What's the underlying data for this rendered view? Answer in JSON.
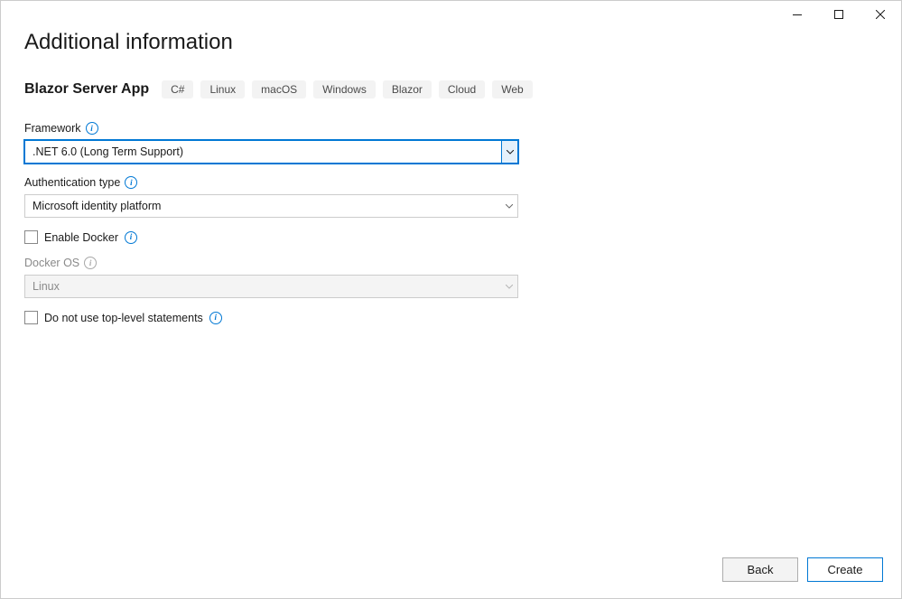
{
  "header": {
    "title": "Additional information"
  },
  "template": {
    "name": "Blazor Server App",
    "tags": [
      "C#",
      "Linux",
      "macOS",
      "Windows",
      "Blazor",
      "Cloud",
      "Web"
    ]
  },
  "fields": {
    "framework": {
      "label": "Framework",
      "value": ".NET 6.0 (Long Term Support)"
    },
    "authType": {
      "label": "Authentication type",
      "value": "Microsoft identity platform"
    },
    "enableDocker": {
      "label": "Enable Docker",
      "checked": false
    },
    "dockerOS": {
      "label": "Docker OS",
      "value": "Linux"
    },
    "topLevel": {
      "label": "Do not use top-level statements",
      "checked": false
    }
  },
  "footer": {
    "back": "Back",
    "create": "Create"
  }
}
